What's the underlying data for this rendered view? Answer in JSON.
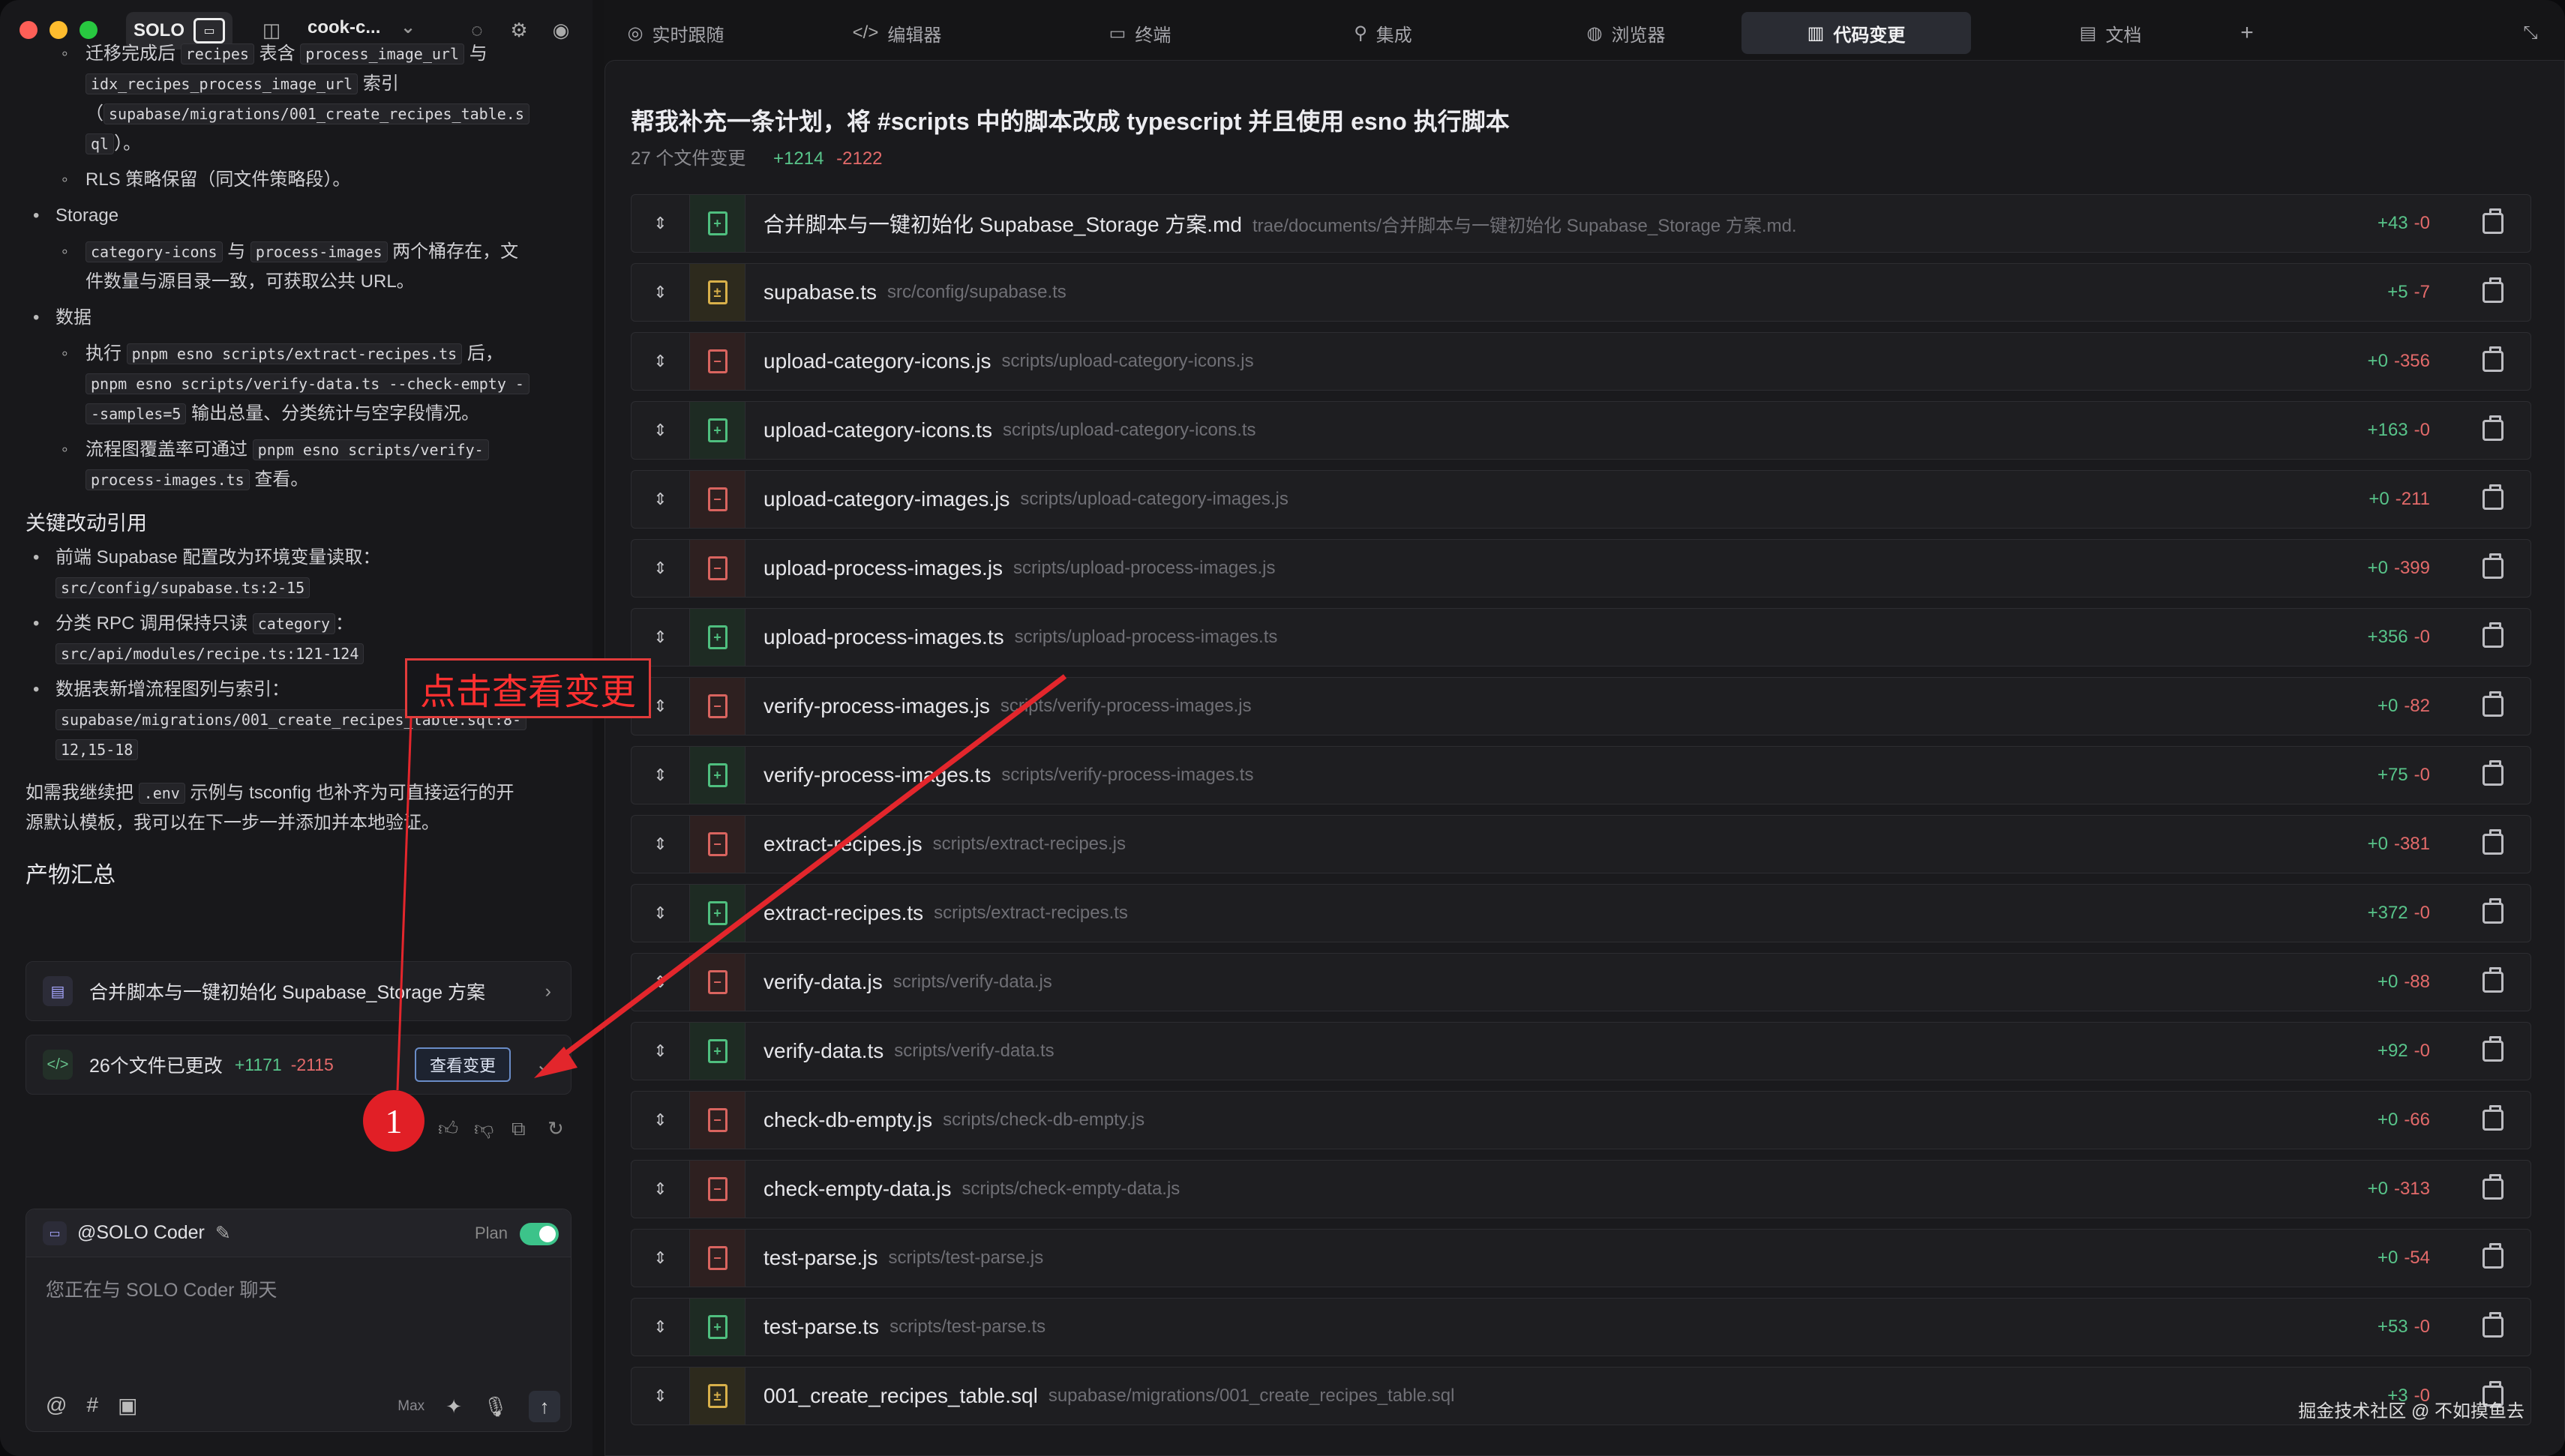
{
  "titlebar": {
    "solo_label": "SOLO",
    "project": "cook-c...",
    "chevron": "⌄"
  },
  "chat": {
    "frag1": "迁移完成后",
    "code_recipes": "recipes",
    "frag2": "表含",
    "code_piu": "process_image_url",
    "frag3": "与",
    "code_idx": "idx_recipes_process_image_url",
    "frag4": "索引",
    "frag5": "（",
    "code_mig_a": "supabase/migrations/001_create_recipes_table.s",
    "code_mig_b": "ql",
    "frag6": "）。",
    "rls": "RLS 策略保留（同文件策略段）。",
    "storage": "Storage",
    "code_ci": "category-icons",
    "frag7": "与",
    "code_pi": "process-images",
    "frag8": "两个桶存在，文",
    "frag9": "件数量与源目录一致，可获取公共 URL。",
    "data_h": "数据",
    "frag10": "执行",
    "code_extract": "pnpm esno scripts/extract-recipes.ts",
    "frag11": "后，",
    "code_verify_a": "pnpm esno scripts/verify-data.ts --check-empty -",
    "code_verify_b": "-samples=5",
    "frag12": "输出总量、分类统计与空字段情况。",
    "frag13": "流程图覆盖率可通过",
    "code_vpi_a": "pnpm esno scripts/verify-",
    "code_vpi_b": "process-images.ts",
    "frag14": "查看。",
    "key_h": "关键改动引用",
    "frag15": "前端 Supabase 配置改为环境变量读取：",
    "code_sb": "src/config/supabase.ts:2-15",
    "frag16": "分类 RPC 调用保持只读",
    "code_cat": "category",
    "frag17": "：",
    "code_recipe": "src/api/modules/recipe.ts:121-124",
    "frag18": "数据表新增流程图列与索引：",
    "code_mig2_a": "supabase/migrations/001_create_recipes_table.sql:8-",
    "code_mig2_b": "12,15-18",
    "frag19": "如需我继续把",
    "code_env": ".env",
    "frag20": "示例与 tsconfig 也补齐为可直接运行的开",
    "frag21": "源默认模板，我可以在下一步一并添加并本地验证。",
    "artifacts_h": "产物汇总"
  },
  "cards": {
    "doc_title": "合并脚本与一键初始化 Supabase_Storage 方案",
    "changes_label": "26个文件已更改",
    "changes_add": "+1171",
    "changes_del": "-2115",
    "view_btn": "查看变更"
  },
  "composer": {
    "agent": "@SOLO Coder",
    "plan": "Plan",
    "placeholder": "您正在与 SOLO Coder 聊天",
    "max": "Max"
  },
  "tabs": [
    {
      "label": "实时跟随",
      "icon": "live-icon"
    },
    {
      "label": "编辑器",
      "icon": "code-icon"
    },
    {
      "label": "终端",
      "icon": "terminal-icon"
    },
    {
      "label": "集成",
      "icon": "integration-icon"
    },
    {
      "label": "浏览器",
      "icon": "browser-icon"
    },
    {
      "label": "代码变更",
      "icon": "diff-icon"
    },
    {
      "label": "文档",
      "icon": "doc-icon"
    },
    {
      "label": "+",
      "icon": "add-icon"
    }
  ],
  "panel": {
    "title": "帮我补充一条计划，将 #scripts 中的脚本改成 typescript 并且使用 esno 执行脚本",
    "count": "27 个文件变更",
    "add": "+1214",
    "del": "-2122"
  },
  "files": [
    {
      "name": "合并脚本与一键初始化 Supabase_Storage 方案.md",
      "path": "trae/documents/合并脚本与一键初始化 Supabase_Storage 方案.md.",
      "add": "+43",
      "del": "-0",
      "kind": "added"
    },
    {
      "name": "supabase.ts",
      "path": "src/config/supabase.ts",
      "add": "+5",
      "del": "-7",
      "kind": "modified"
    },
    {
      "name": "upload-category-icons.js",
      "path": "scripts/upload-category-icons.js",
      "add": "+0",
      "del": "-356",
      "kind": "deleted"
    },
    {
      "name": "upload-category-icons.ts",
      "path": "scripts/upload-category-icons.ts",
      "add": "+163",
      "del": "-0",
      "kind": "added"
    },
    {
      "name": "upload-category-images.js",
      "path": "scripts/upload-category-images.js",
      "add": "+0",
      "del": "-211",
      "kind": "deleted"
    },
    {
      "name": "upload-process-images.js",
      "path": "scripts/upload-process-images.js",
      "add": "+0",
      "del": "-399",
      "kind": "deleted"
    },
    {
      "name": "upload-process-images.ts",
      "path": "scripts/upload-process-images.ts",
      "add": "+356",
      "del": "-0",
      "kind": "added"
    },
    {
      "name": "verify-process-images.js",
      "path": "scripts/verify-process-images.js",
      "add": "+0",
      "del": "-82",
      "kind": "deleted"
    },
    {
      "name": "verify-process-images.ts",
      "path": "scripts/verify-process-images.ts",
      "add": "+75",
      "del": "-0",
      "kind": "added"
    },
    {
      "name": "extract-recipes.js",
      "path": "scripts/extract-recipes.js",
      "add": "+0",
      "del": "-381",
      "kind": "deleted"
    },
    {
      "name": "extract-recipes.ts",
      "path": "scripts/extract-recipes.ts",
      "add": "+372",
      "del": "-0",
      "kind": "added"
    },
    {
      "name": "verify-data.js",
      "path": "scripts/verify-data.js",
      "add": "+0",
      "del": "-88",
      "kind": "deleted"
    },
    {
      "name": "verify-data.ts",
      "path": "scripts/verify-data.ts",
      "add": "+92",
      "del": "-0",
      "kind": "added"
    },
    {
      "name": "check-db-empty.js",
      "path": "scripts/check-db-empty.js",
      "add": "+0",
      "del": "-66",
      "kind": "deleted"
    },
    {
      "name": "check-empty-data.js",
      "path": "scripts/check-empty-data.js",
      "add": "+0",
      "del": "-313",
      "kind": "deleted"
    },
    {
      "name": "test-parse.js",
      "path": "scripts/test-parse.js",
      "add": "+0",
      "del": "-54",
      "kind": "deleted"
    },
    {
      "name": "test-parse.ts",
      "path": "scripts/test-parse.ts",
      "add": "+53",
      "del": "-0",
      "kind": "added"
    },
    {
      "name": "001_create_recipes_table.sql",
      "path": "supabase/migrations/001_create_recipes_table.sql",
      "add": "+3",
      "del": "-0",
      "kind": "modified"
    }
  ],
  "annotation": {
    "callout": "点击查看变更",
    "step": "1"
  },
  "watermark": "掘金技术社区 @ 不如摸鱼去",
  "colors": {
    "added": "#4fbf7f",
    "deleted": "#d9645f",
    "modified": "#d8b04a",
    "annotation": "#e11f26"
  }
}
